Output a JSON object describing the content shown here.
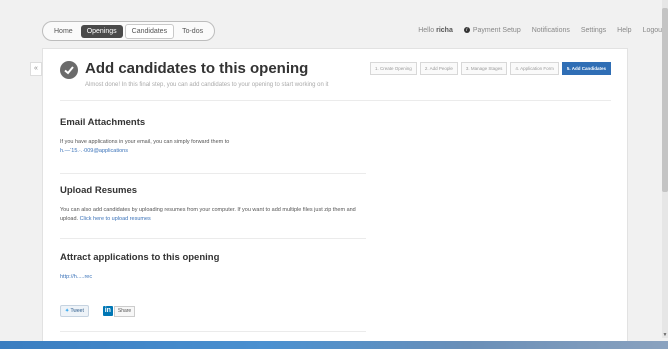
{
  "nav": {
    "tabs": [
      "Home",
      "Openings",
      "Candidates",
      "To-dos"
    ],
    "greeting_prefix": "Hello",
    "user": "richa",
    "links": [
      "Payment Setup",
      "Notifications",
      "Settings",
      "Help",
      "Logout"
    ]
  },
  "page": {
    "title": "Add candidates to this opening",
    "subtitle": "Almost done! In this final step, you can add candidates to your opening to start working on it",
    "steps": [
      "1. Create Opening",
      "2. Add People",
      "3. Manage Stages",
      "4. Application Form",
      "5. Add Candidates"
    ]
  },
  "email_section": {
    "title": "Email Attachments",
    "text": "If you have applications in your email, you can simply forward them to",
    "email": "h.—‘15.·.·009@applications"
  },
  "resume_section": {
    "title": "Upload Resumes",
    "text": "You can also add candidates by uploading resumes from your computer. If you want to add multiple files just zip them and upload.",
    "link": "Click here to upload resumes"
  },
  "attract_section": {
    "title": "Attract applications to this opening",
    "url": "http://h.....rec"
  },
  "share": {
    "tweet": "Tweet",
    "linkedin_icon": "in",
    "linkedin_label": "Share"
  },
  "collapse_label": "«",
  "colors": {
    "accent": "#2f6eb5",
    "link": "#3b73b9",
    "dark_tab": "#4a4a4a"
  }
}
